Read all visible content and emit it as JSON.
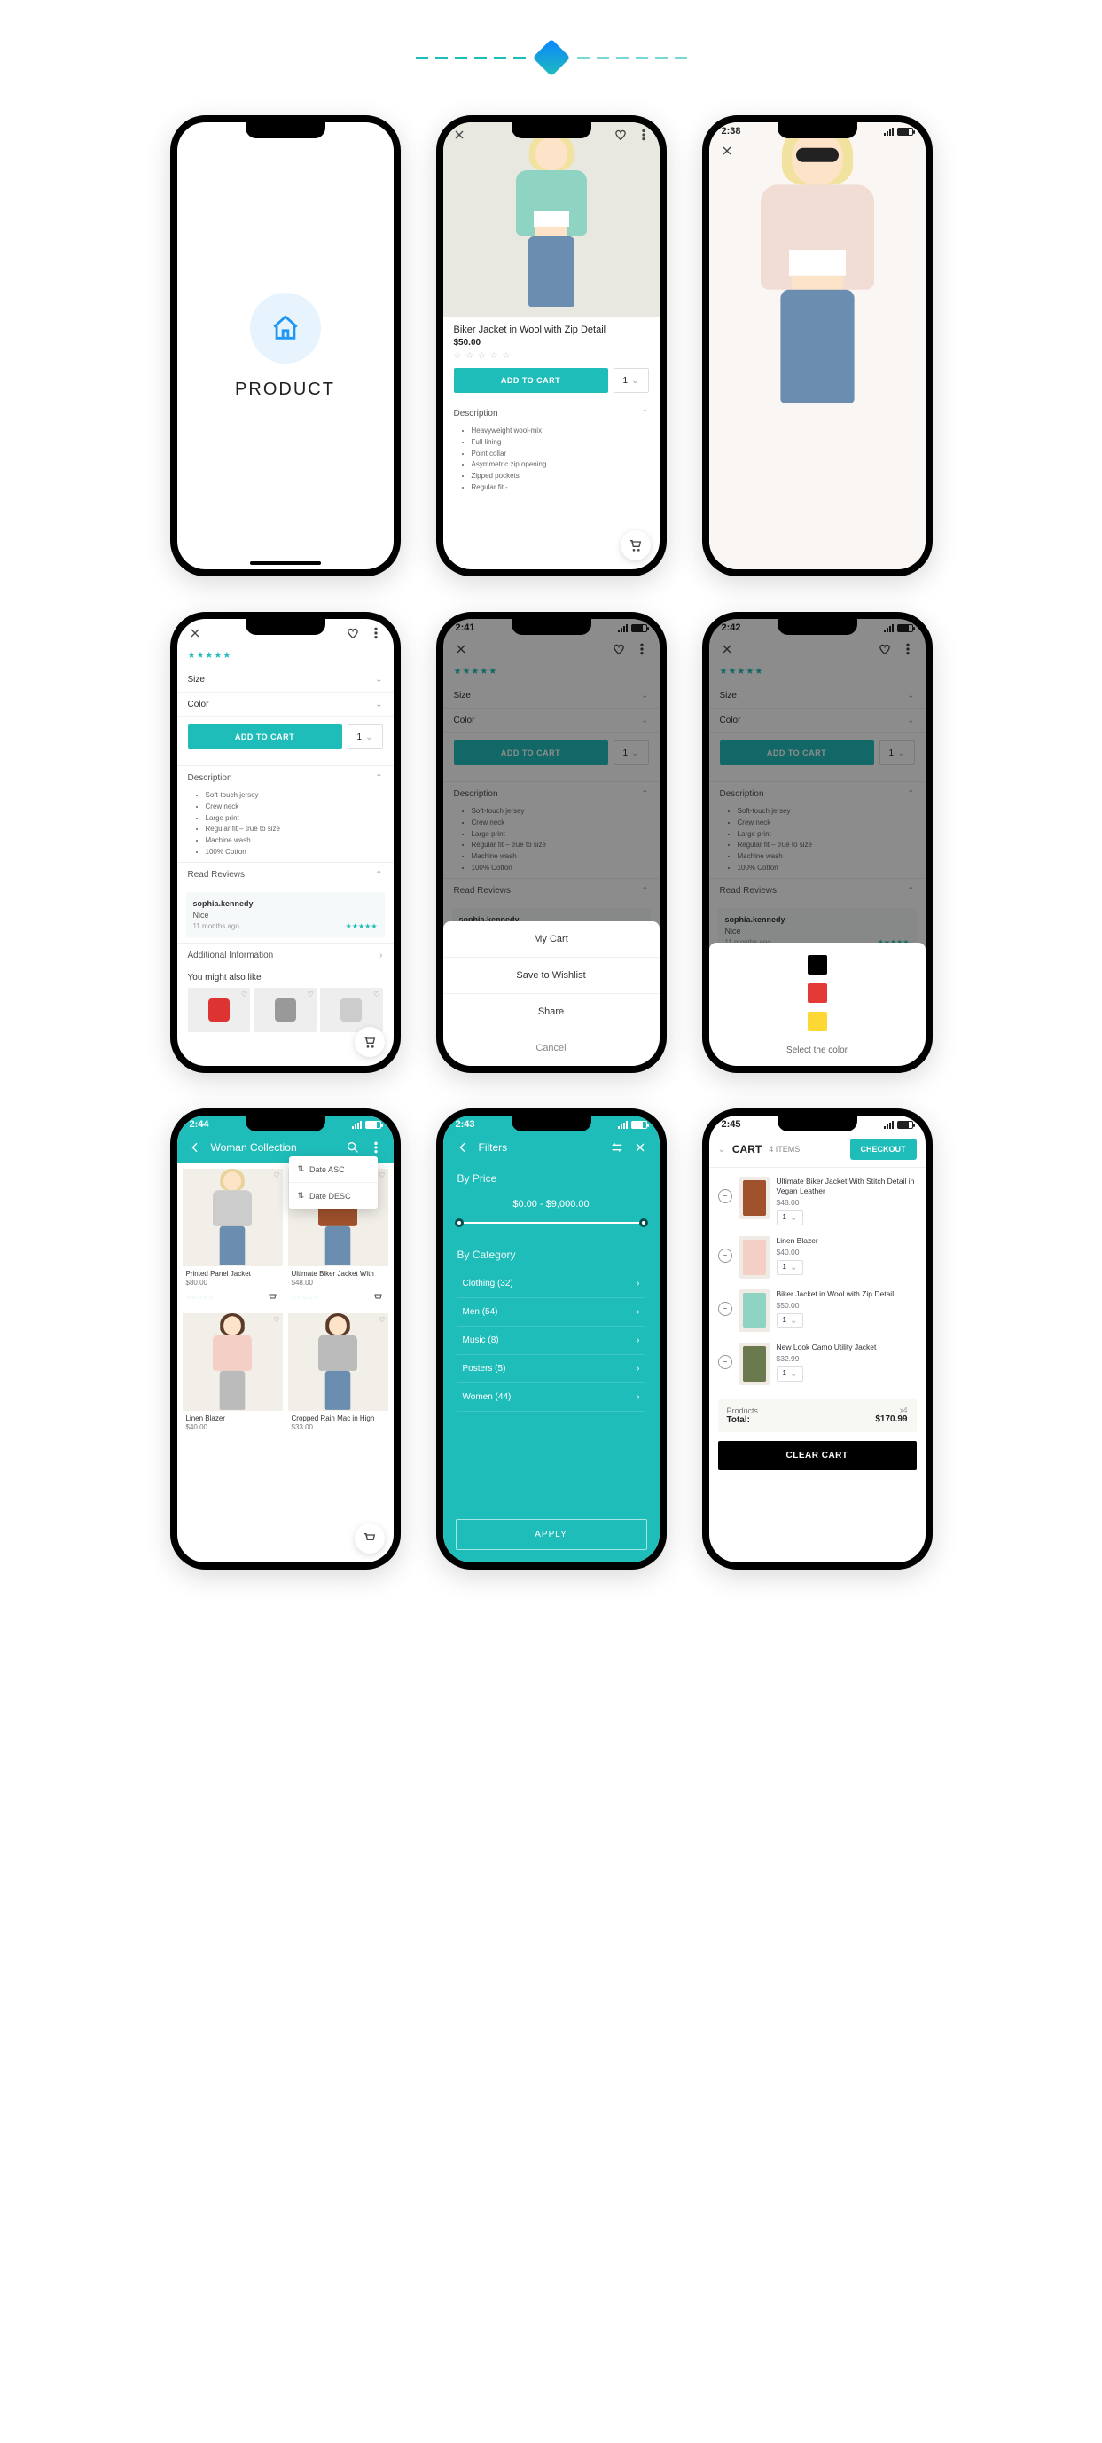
{
  "divider": {
    "present": true
  },
  "screens": {
    "splash": {
      "title": "PRODUCT"
    },
    "product1": {
      "title": "Biker Jacket in Wool with Zip Detail",
      "price": "$50.00",
      "add_to_cart": "ADD TO CART",
      "qty": "1",
      "desc_head": "Description",
      "bullets": [
        "Heavyweight wool-mix",
        "Full lining",
        "Point collar",
        "Asymmetric zip opening",
        "Zipped pockets",
        "Regular fit - …"
      ]
    },
    "fullscreen": {
      "status_time": "2:38"
    },
    "detail": {
      "size_label": "Size",
      "color_label": "Color",
      "add_to_cart": "ADD TO CART",
      "qty": "1",
      "desc_head": "Description",
      "bullets": [
        "Soft-touch jersey",
        "Crew neck",
        "Large print",
        "Regular fit – true to size",
        "Machine wash",
        "100% Cotton"
      ],
      "reviews_head": "Read Reviews",
      "review": {
        "name": "sophia.kennedy",
        "text": "Nice",
        "ago": "11 months ago"
      },
      "addl_head": "Additional Information",
      "might_like": "You might also like"
    },
    "sheet1": {
      "status_time": "2:41",
      "items": [
        "My Cart",
        "Save to Wishlist",
        "Share",
        "Cancel"
      ]
    },
    "sheet2": {
      "status_time": "2:42",
      "label": "Select the color"
    },
    "collection": {
      "status_time": "2:44",
      "title": "Woman Collection",
      "sort": [
        "Date ASC",
        "Date DESC"
      ],
      "products": [
        {
          "name": "Printed Panel Jacket",
          "price": "$80.00"
        },
        {
          "name": "Ultimate Biker Jacket With",
          "price": "$48.00"
        },
        {
          "name": "Linen Blazer",
          "price": "$40.00"
        },
        {
          "name": "Cropped Rain Mac in High",
          "price": "$33.00"
        }
      ]
    },
    "filters": {
      "status_time": "2:43",
      "title": "Filters",
      "by_price": "By Price",
      "price_range": "$0.00 - $9,000.00",
      "by_category": "By Category",
      "categories": [
        {
          "label": "Clothing (32)"
        },
        {
          "label": "Men (54)"
        },
        {
          "label": "Music (8)"
        },
        {
          "label": "Posters (5)"
        },
        {
          "label": "Women (44)"
        }
      ],
      "apply": "APPLY"
    },
    "cart": {
      "status_time": "2:45",
      "title": "CART",
      "count": "4 ITEMS",
      "checkout": "CHECKOUT",
      "items": [
        {
          "name": "Ultimate Biker Jacket With Stitch Detail in Vegan Leather",
          "price": "$48.00",
          "qty": "1"
        },
        {
          "name": "Linen Blazer",
          "price": "$40.00",
          "qty": "1"
        },
        {
          "name": "Biker Jacket in Wool with Zip Detail",
          "price": "$50.00",
          "qty": "1"
        },
        {
          "name": "New Look Camo Utility Jacket",
          "price": "$32.99",
          "qty": "1"
        }
      ],
      "products_label": "Products",
      "products_count": "x4",
      "total_label": "Total:",
      "total": "$170.99",
      "clear": "CLEAR CART"
    }
  }
}
